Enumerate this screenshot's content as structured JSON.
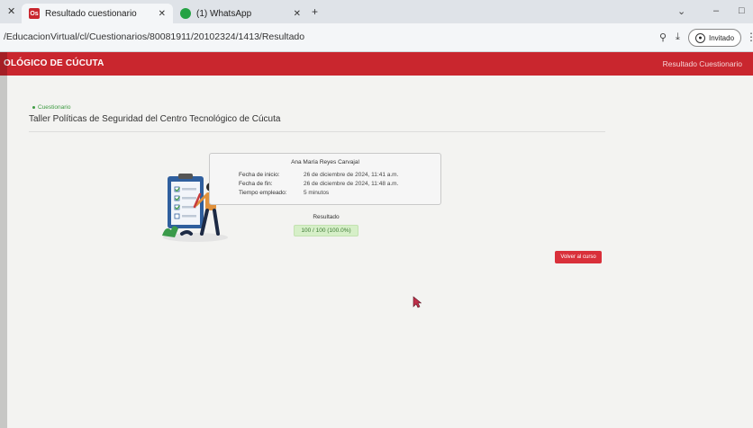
{
  "browser": {
    "tabs": [
      {
        "title": "Resultado cuestionario",
        "favicon_text": "Os",
        "active": true
      },
      {
        "title": "(1) WhatsApp",
        "favicon_text": "",
        "active": false
      }
    ],
    "url": "/EducacionVirtual/cl/Cuestionarios/80081911/20102324/1413/Resultado",
    "profile_label": "Invitado"
  },
  "header": {
    "brand": "OLÓGICO DE CÚCUTA",
    "right_link": "Resultado Cuestionario"
  },
  "main": {
    "breadcrumb": "Cuestionario",
    "title": "Taller Políticas de Seguridad del Centro Tecnológico de Cúcuta",
    "student_name": "Ana María Reyes Carvajal",
    "fields": [
      {
        "label": "Fecha de inicio:",
        "value": "26 de diciembre de 2024, 11:41 a.m."
      },
      {
        "label": "Fecha de fin:",
        "value": "26 de diciembre de 2024, 11:48 a.m."
      },
      {
        "label": "Tiempo empleado:",
        "value": "5 minutos"
      }
    ],
    "result_label": "Resultado",
    "score": "100 / 100 (100.0%)",
    "back_button": "Volver al curso"
  },
  "colors": {
    "brand_red": "#c9262e",
    "button_red": "#d9303a",
    "score_green_bg": "#d6efc8",
    "breadcrumb_green": "#3d9b42"
  }
}
